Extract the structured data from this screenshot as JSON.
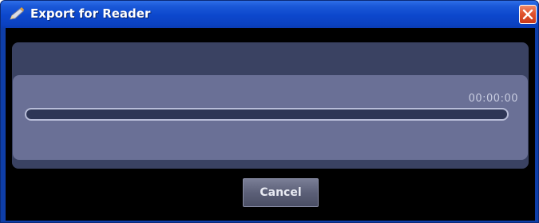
{
  "window": {
    "title": "Export for Reader",
    "title_icon": "pencil-icon",
    "close_icon": "close-icon"
  },
  "progress": {
    "time": "00:00:00",
    "fraction": 0
  },
  "buttons": {
    "cancel_label": "Cancel"
  },
  "colors": {
    "titlebar": "#0c47cc",
    "close_button": "#e0532e",
    "panel_outer": "#3a4262",
    "panel_inner": "#6a7096",
    "progress_track": "#2e3656"
  }
}
